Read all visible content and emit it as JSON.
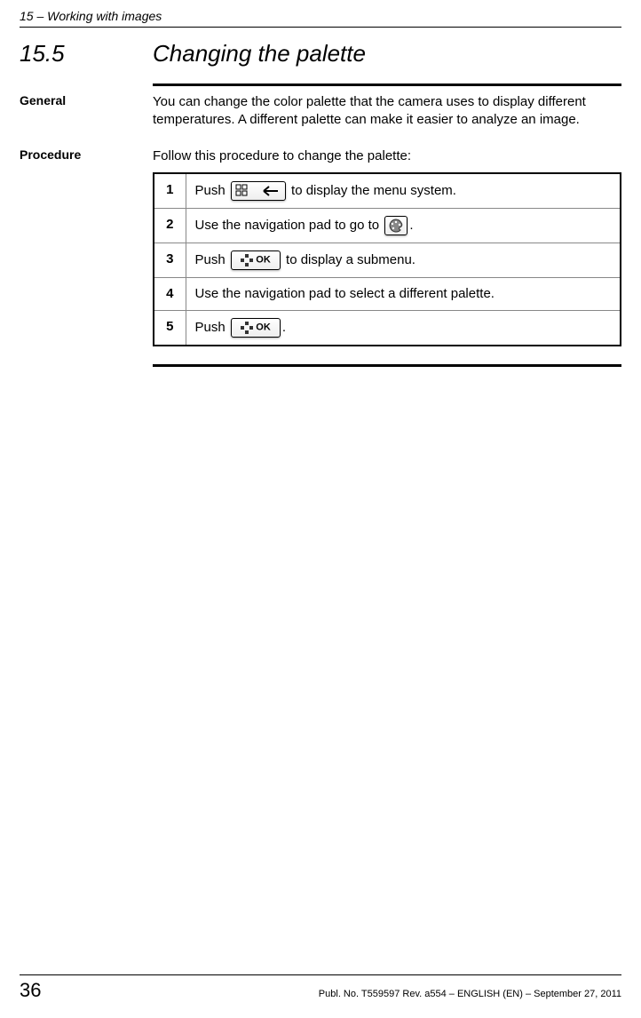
{
  "header": {
    "running": "15 – Working with images"
  },
  "section": {
    "number": "15.5",
    "title": "Changing the palette"
  },
  "general": {
    "label": "General",
    "text": "You can change the color palette that the camera uses to display different temperatures. A different palette can make it easier to analyze an image."
  },
  "procedure": {
    "label": "Procedure",
    "intro": "Follow this procedure to change the palette:",
    "steps": [
      {
        "n": "1",
        "before": "Push ",
        "iconType": "menu",
        "after": " to display the menu system."
      },
      {
        "n": "2",
        "before": "Use the navigation pad to go to ",
        "iconType": "palette",
        "after": "."
      },
      {
        "n": "3",
        "before": "Push ",
        "iconType": "ok",
        "after": " to display a submenu."
      },
      {
        "n": "4",
        "before": "Use the navigation pad to select a different palette.",
        "iconType": "",
        "after": ""
      },
      {
        "n": "5",
        "before": "Push ",
        "iconType": "ok",
        "after": "."
      }
    ]
  },
  "footer": {
    "page": "36",
    "text": "Publ. No. T559597 Rev. a554 – ENGLISH (EN) – September 27, 2011"
  }
}
